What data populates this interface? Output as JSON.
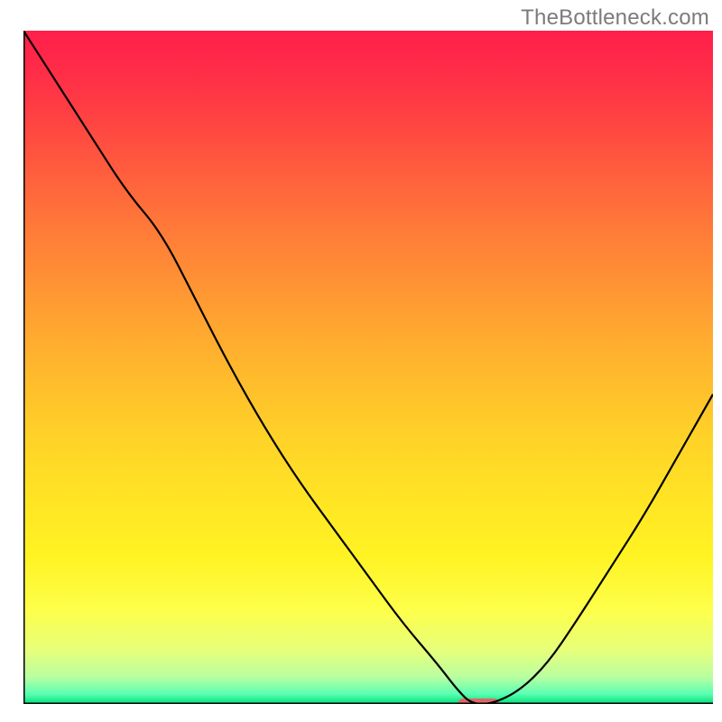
{
  "watermark": "TheBottleneck.com",
  "chart_data": {
    "type": "line",
    "title": "",
    "xlabel": "",
    "ylabel": "",
    "xlim": [
      0,
      100
    ],
    "ylim": [
      0,
      100
    ],
    "x": [
      0,
      5,
      10,
      15,
      20,
      25,
      30,
      35,
      40,
      45,
      50,
      55,
      60,
      63,
      65,
      68,
      72,
      76,
      80,
      85,
      90,
      95,
      100
    ],
    "values": [
      100,
      92,
      84,
      76,
      70,
      60,
      50,
      41,
      33,
      26,
      19,
      12,
      6,
      2,
      0,
      0,
      2,
      6,
      12,
      20,
      28,
      37,
      46
    ],
    "optimum": {
      "x": 66,
      "width": 6,
      "color": "#e06666"
    },
    "gradient_stops": [
      {
        "offset": 0.0,
        "color": "#ff1f4b"
      },
      {
        "offset": 0.05,
        "color": "#ff2a48"
      },
      {
        "offset": 0.1,
        "color": "#ff3845"
      },
      {
        "offset": 0.2,
        "color": "#ff5a3e"
      },
      {
        "offset": 0.3,
        "color": "#ff7c38"
      },
      {
        "offset": 0.4,
        "color": "#ff9a33"
      },
      {
        "offset": 0.5,
        "color": "#ffb72d"
      },
      {
        "offset": 0.6,
        "color": "#ffd128"
      },
      {
        "offset": 0.7,
        "color": "#ffe524"
      },
      {
        "offset": 0.78,
        "color": "#fff323"
      },
      {
        "offset": 0.86,
        "color": "#fdff4a"
      },
      {
        "offset": 0.92,
        "color": "#e7ff7a"
      },
      {
        "offset": 0.96,
        "color": "#b9ffa0"
      },
      {
        "offset": 0.985,
        "color": "#5bffb3"
      },
      {
        "offset": 1.0,
        "color": "#00e07a"
      }
    ],
    "axis_color": "#000000",
    "line_color": "#000000"
  }
}
